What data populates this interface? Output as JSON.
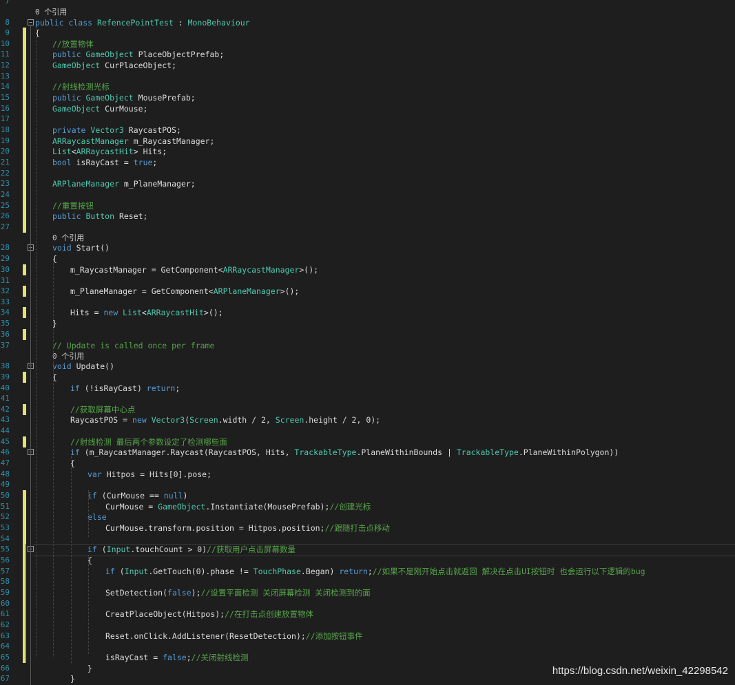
{
  "editor": {
    "lines": [
      {
        "num": "7",
        "segs": []
      },
      {
        "num": "",
        "ref": true,
        "segs": [
          {
            "t": "0 个引用",
            "c": "ref"
          }
        ]
      },
      {
        "num": "8",
        "segs": [
          {
            "t": "public class ",
            "c": "kw"
          },
          {
            "t": "RefencePointTest",
            "c": "ty"
          },
          {
            "t": " : "
          },
          {
            "t": "MonoBehaviour",
            "c": "ty"
          }
        ]
      },
      {
        "num": "9",
        "segs": [
          {
            "t": "{"
          }
        ]
      },
      {
        "num": "10",
        "segs": [
          {
            "t": "//放置物体",
            "c": "cm"
          }
        ]
      },
      {
        "num": "11",
        "segs": [
          {
            "t": "public ",
            "c": "kw"
          },
          {
            "t": "GameObject",
            "c": "ty"
          },
          {
            "t": " PlaceObjectPrefab;"
          }
        ]
      },
      {
        "num": "12",
        "segs": [
          {
            "t": "GameObject",
            "c": "ty"
          },
          {
            "t": " CurPlaceObject;"
          }
        ]
      },
      {
        "num": "13",
        "segs": []
      },
      {
        "num": "14",
        "segs": [
          {
            "t": "//射线检测光标",
            "c": "cm"
          }
        ]
      },
      {
        "num": "15",
        "segs": [
          {
            "t": "public ",
            "c": "kw"
          },
          {
            "t": "GameObject",
            "c": "ty"
          },
          {
            "t": " MousePrefab;"
          }
        ]
      },
      {
        "num": "16",
        "segs": [
          {
            "t": "GameObject",
            "c": "ty"
          },
          {
            "t": " CurMouse;"
          }
        ]
      },
      {
        "num": "17",
        "segs": []
      },
      {
        "num": "18",
        "segs": [
          {
            "t": "private ",
            "c": "kw"
          },
          {
            "t": "Vector3",
            "c": "ty"
          },
          {
            "t": " RaycastPOS;"
          }
        ]
      },
      {
        "num": "19",
        "segs": [
          {
            "t": "ARRaycastManager",
            "c": "ty"
          },
          {
            "t": " m_RaycastManager;"
          }
        ]
      },
      {
        "num": "20",
        "segs": [
          {
            "t": "List",
            "c": "ty"
          },
          {
            "t": "<"
          },
          {
            "t": "ARRaycastHit",
            "c": "ty"
          },
          {
            "t": "> Hits;"
          }
        ]
      },
      {
        "num": "21",
        "segs": [
          {
            "t": "bool",
            "c": "kw"
          },
          {
            "t": " isRayCast = "
          },
          {
            "t": "true",
            "c": "kw"
          },
          {
            "t": ";"
          }
        ]
      },
      {
        "num": "22",
        "segs": []
      },
      {
        "num": "23",
        "segs": [
          {
            "t": "ARPlaneManager",
            "c": "ty"
          },
          {
            "t": " m_PlaneManager;"
          }
        ]
      },
      {
        "num": "24",
        "segs": []
      },
      {
        "num": "25",
        "segs": [
          {
            "t": "//重置按钮",
            "c": "cm"
          }
        ]
      },
      {
        "num": "26",
        "segs": [
          {
            "t": "public ",
            "c": "kw"
          },
          {
            "t": "Button",
            "c": "ty"
          },
          {
            "t": " Reset;"
          }
        ]
      },
      {
        "num": "27",
        "segs": []
      },
      {
        "num": "",
        "ref": true,
        "segs": [
          {
            "t": "0 个引用",
            "c": "ref"
          }
        ]
      },
      {
        "num": "28",
        "segs": [
          {
            "t": "void",
            "c": "kw"
          },
          {
            "t": " Start()"
          }
        ]
      },
      {
        "num": "29",
        "segs": [
          {
            "t": "{"
          }
        ]
      },
      {
        "num": "30",
        "segs": [
          {
            "t": "m_RaycastManager = GetComponent<"
          },
          {
            "t": "ARRaycastManager",
            "c": "ty"
          },
          {
            "t": ">();"
          }
        ]
      },
      {
        "num": "31",
        "segs": []
      },
      {
        "num": "32",
        "segs": [
          {
            "t": "m_PlaneManager = GetComponent<"
          },
          {
            "t": "ARPlaneManager",
            "c": "ty"
          },
          {
            "t": ">();"
          }
        ]
      },
      {
        "num": "33",
        "segs": []
      },
      {
        "num": "34",
        "segs": [
          {
            "t": "Hits = "
          },
          {
            "t": "new ",
            "c": "kw"
          },
          {
            "t": "List",
            "c": "ty"
          },
          {
            "t": "<"
          },
          {
            "t": "ARRaycastHit",
            "c": "ty"
          },
          {
            "t": ">();"
          }
        ]
      },
      {
        "num": "35",
        "segs": [
          {
            "t": "}"
          }
        ]
      },
      {
        "num": "36",
        "segs": []
      },
      {
        "num": "37",
        "segs": [
          {
            "t": "// Update is called once per frame",
            "c": "cm"
          }
        ]
      },
      {
        "num": "",
        "ref": true,
        "segs": [
          {
            "t": "0 个引用",
            "c": "ref"
          }
        ]
      },
      {
        "num": "38",
        "segs": [
          {
            "t": "void",
            "c": "kw"
          },
          {
            "t": " Update()"
          }
        ]
      },
      {
        "num": "39",
        "segs": [
          {
            "t": "{"
          }
        ]
      },
      {
        "num": "40",
        "segs": [
          {
            "t": "if",
            "c": "kw"
          },
          {
            "t": " (!isRayCast) "
          },
          {
            "t": "return",
            "c": "kw"
          },
          {
            "t": ";"
          }
        ]
      },
      {
        "num": "41",
        "segs": []
      },
      {
        "num": "42",
        "segs": [
          {
            "t": "//获取屏幕中心点",
            "c": "cm"
          }
        ]
      },
      {
        "num": "43",
        "segs": [
          {
            "t": "RaycastPOS = "
          },
          {
            "t": "new ",
            "c": "kw"
          },
          {
            "t": "Vector3",
            "c": "ty"
          },
          {
            "t": "("
          },
          {
            "t": "Screen",
            "c": "ty"
          },
          {
            "t": ".width / 2, "
          },
          {
            "t": "Screen",
            "c": "ty"
          },
          {
            "t": ".height / 2, 0);"
          }
        ]
      },
      {
        "num": "44",
        "segs": []
      },
      {
        "num": "45",
        "segs": [
          {
            "t": "//射线检测 最后两个参数设定了检测哪些面",
            "c": "cm"
          }
        ]
      },
      {
        "num": "46",
        "segs": [
          {
            "t": "if",
            "c": "kw"
          },
          {
            "t": " (m_RaycastManager.Raycast(RaycastPOS, Hits, "
          },
          {
            "t": "TrackableType",
            "c": "ty"
          },
          {
            "t": ".PlaneWithinBounds | "
          },
          {
            "t": "TrackableType",
            "c": "ty"
          },
          {
            "t": ".PlaneWithinPolygon))"
          }
        ]
      },
      {
        "num": "47",
        "segs": [
          {
            "t": "{"
          }
        ]
      },
      {
        "num": "48",
        "segs": [
          {
            "t": "var",
            "c": "kw"
          },
          {
            "t": " Hitpos = Hits[0].pose;"
          }
        ]
      },
      {
        "num": "49",
        "segs": []
      },
      {
        "num": "50",
        "segs": [
          {
            "t": "if",
            "c": "kw"
          },
          {
            "t": " (CurMouse == "
          },
          {
            "t": "null",
            "c": "kw"
          },
          {
            "t": ")"
          }
        ]
      },
      {
        "num": "51",
        "segs": [
          {
            "t": "CurMouse = "
          },
          {
            "t": "GameObject",
            "c": "ty"
          },
          {
            "t": ".Instantiate(MousePrefab);"
          },
          {
            "t": "//创建光标",
            "c": "cm"
          }
        ]
      },
      {
        "num": "52",
        "segs": [
          {
            "t": "else",
            "c": "kw"
          }
        ]
      },
      {
        "num": "53",
        "segs": [
          {
            "t": "CurMouse.transform.position = Hitpos.position;"
          },
          {
            "t": "//跟随打击点移动",
            "c": "cm"
          }
        ]
      },
      {
        "num": "54",
        "segs": []
      },
      {
        "num": "55",
        "segs": [
          {
            "t": "if",
            "c": "kw"
          },
          {
            "t": " ("
          },
          {
            "t": "Input",
            "c": "ty"
          },
          {
            "t": ".touchCount > 0)"
          },
          {
            "t": "//获取用户点击屏幕数量",
            "c": "cm"
          }
        ]
      },
      {
        "num": "56",
        "segs": [
          {
            "t": "{"
          }
        ]
      },
      {
        "num": "57",
        "segs": [
          {
            "t": "if",
            "c": "kw"
          },
          {
            "t": " ("
          },
          {
            "t": "Input",
            "c": "ty"
          },
          {
            "t": ".GetTouch(0).phase != "
          },
          {
            "t": "TouchPhase",
            "c": "ty"
          },
          {
            "t": ".Began) "
          },
          {
            "t": "return",
            "c": "kw"
          },
          {
            "t": ";"
          },
          {
            "t": "//如果不是刚开始点击就返回 解决在点击UI按钮时 也会运行以下逻辑的bug",
            "c": "cm"
          }
        ]
      },
      {
        "num": "58",
        "segs": []
      },
      {
        "num": "59",
        "segs": [
          {
            "t": "SetDetection("
          },
          {
            "t": "false",
            "c": "kw"
          },
          {
            "t": ");"
          },
          {
            "t": "//设置平面检测 关闭屏幕检测 关闭检测到的面",
            "c": "cm"
          }
        ]
      },
      {
        "num": "60",
        "segs": []
      },
      {
        "num": "61",
        "segs": [
          {
            "t": "CreatPlaceObject(Hitpos);"
          },
          {
            "t": "//在打击点创建放置物体",
            "c": "cm"
          }
        ]
      },
      {
        "num": "62",
        "segs": []
      },
      {
        "num": "63",
        "segs": [
          {
            "t": "Reset.onClick.AddListener(ResetDetection);"
          },
          {
            "t": "//添加按钮事件",
            "c": "cm"
          }
        ]
      },
      {
        "num": "64",
        "segs": []
      },
      {
        "num": "65",
        "segs": [
          {
            "t": "isRayCast = "
          },
          {
            "t": "false",
            "c": "kw"
          },
          {
            "t": ";"
          },
          {
            "t": "//关闭射线检测",
            "c": "cm"
          }
        ]
      },
      {
        "num": "66",
        "segs": [
          {
            "t": "}"
          }
        ]
      },
      {
        "num": "67",
        "segs": [
          {
            "t": "}"
          }
        ]
      }
    ]
  },
  "watermark": "https://blog.csdn.net/weixin_42298542",
  "colors": {
    "background": "#1e1e1e",
    "keyword": "#569cd6",
    "type": "#4ec9b0",
    "comment": "#57a64a",
    "line_number": "#2b91af",
    "change_bar_saved": "#e5e071",
    "change_bar_gray": "#9a9a9a"
  }
}
